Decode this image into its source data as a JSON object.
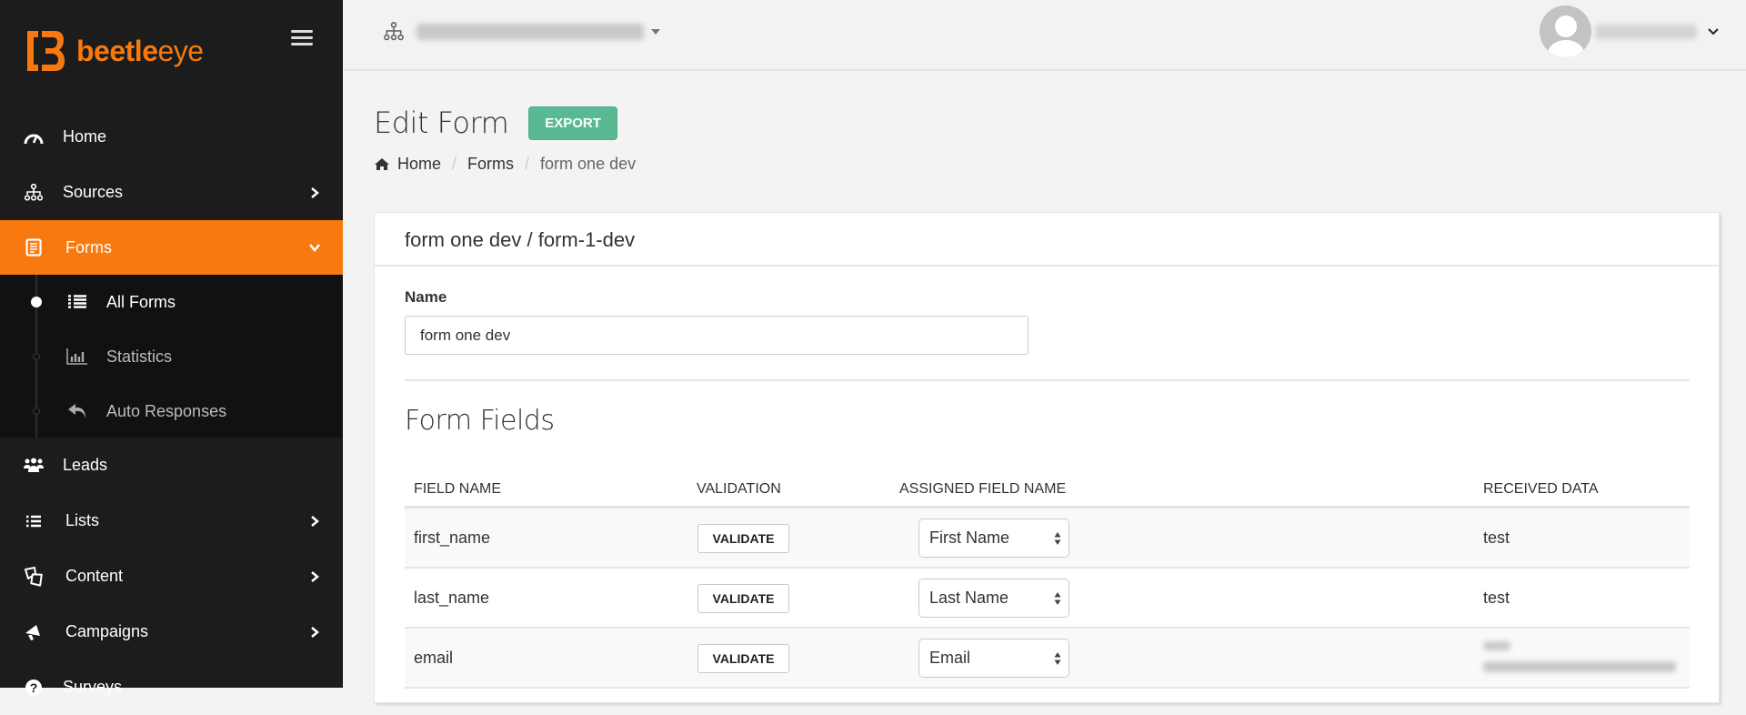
{
  "brand": {
    "name_bold": "beetle",
    "name_light": "eye",
    "accent": "#f7790f"
  },
  "sidebar": {
    "items": [
      {
        "label": "Home",
        "icon": "dashboard-icon",
        "has_chevron": false
      },
      {
        "label": "Sources",
        "icon": "sitemap-icon",
        "has_chevron": true
      },
      {
        "label": "Forms",
        "icon": "form-icon",
        "has_chevron": true,
        "active": true,
        "expanded": true,
        "children": [
          {
            "label": "All Forms",
            "icon": "list-icon",
            "active": true
          },
          {
            "label": "Statistics",
            "icon": "bar-chart-icon"
          },
          {
            "label": "Auto Responses",
            "icon": "reply-icon"
          }
        ]
      },
      {
        "label": "Leads",
        "icon": "users-icon",
        "has_chevron": false
      },
      {
        "label": "Lists",
        "icon": "list-ul-icon",
        "has_chevron": true
      },
      {
        "label": "Content",
        "icon": "content-icon",
        "has_chevron": true
      },
      {
        "label": "Campaigns",
        "icon": "bullhorn-icon",
        "has_chevron": true
      },
      {
        "label": "Surveys",
        "icon": "question-icon",
        "has_chevron": false
      }
    ]
  },
  "header": {
    "org_selector": {
      "value": "[blurred]",
      "icon": "sitemap-icon"
    },
    "user": {
      "name": "[blurred]"
    }
  },
  "page": {
    "title": "Edit Form",
    "export_label": "EXPORT",
    "breadcrumb": [
      {
        "label": "Home",
        "icon": "home-icon"
      },
      {
        "label": "Forms"
      },
      {
        "label": "form one dev"
      }
    ]
  },
  "card": {
    "title": "form one dev / form-1-dev",
    "name_label": "Name",
    "name_value": "form one dev",
    "section_title": "Form Fields",
    "table": {
      "columns": [
        "FIELD NAME",
        "VALIDATION",
        "ASSIGNED FIELD NAME",
        "RECEIVED DATA"
      ],
      "validate_label": "VALIDATE",
      "rows": [
        {
          "field_name": "first_name",
          "assigned": "First Name",
          "received": "test"
        },
        {
          "field_name": "last_name",
          "assigned": "Last Name",
          "received": "test"
        },
        {
          "field_name": "email",
          "assigned": "Email",
          "received": "[blurred]"
        }
      ]
    }
  }
}
